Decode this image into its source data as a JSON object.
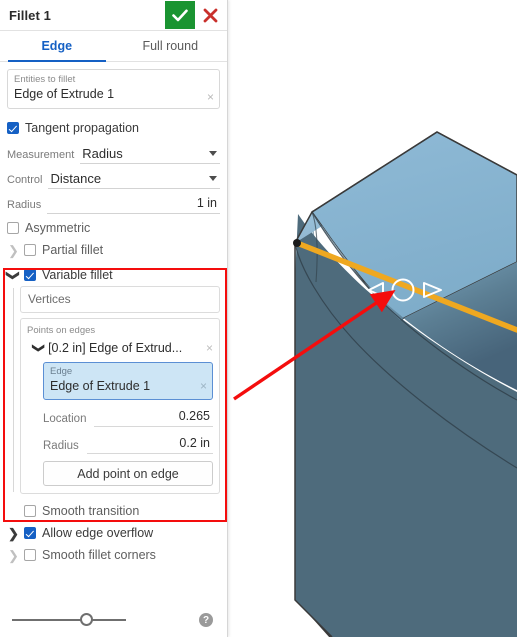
{
  "dialog": {
    "title": "Fillet 1",
    "accept_icon": "check-icon",
    "cancel_icon": "close-icon",
    "tabs": [
      {
        "label": "Edge",
        "active": true
      },
      {
        "label": "Full round",
        "active": false
      }
    ],
    "entities_field": {
      "label": "Entities to fillet",
      "value": "Edge of Extrude 1",
      "clear_glyph": "×"
    },
    "tangent_propagation": {
      "label": "Tangent propagation",
      "checked": true
    },
    "measurement": {
      "label": "Measurement",
      "value": "Radius"
    },
    "control": {
      "label": "Control",
      "value": "Distance"
    },
    "radius": {
      "label": "Radius",
      "value": "1 in"
    },
    "asymmetric": {
      "label": "Asymmetric",
      "checked": false
    },
    "partial_fillet": {
      "label": "Partial fillet",
      "checked": false
    },
    "variable_fillet": {
      "label": "Variable fillet",
      "checked": true,
      "vertices_placeholder": "Vertices",
      "points_on_edges": {
        "label": "Points on edges",
        "item_title": "[0.2 in] Edge of Extrud...",
        "item_clear_glyph": "×",
        "edge_field": {
          "label": "Edge",
          "value": "Edge of Extrude 1",
          "clear_glyph": "×"
        },
        "location": {
          "label": "Location",
          "value": "0.265"
        },
        "radius": {
          "label": "Radius",
          "value": "0.2 in"
        },
        "add_point_button": "Add point on edge"
      }
    },
    "smooth_transition": {
      "label": "Smooth transition",
      "checked": false
    },
    "allow_edge_overflow": {
      "label": "Allow edge overflow",
      "checked": true
    },
    "smooth_fillet_corners": {
      "label": "Smooth fillet corners",
      "checked": false
    },
    "footer": {
      "slider_value": 60,
      "help_glyph": "?"
    }
  },
  "viewport": {
    "handle_color": "#efa820",
    "annotation_color": "#f40d0d",
    "face_top_color": "#85b2cf",
    "face_front_color": "#4e6b7c",
    "edge_color": "#3a3a3a",
    "manipulator": {
      "left_arrow_icon": "triangle-left-icon",
      "circle_icon": "circle-handle-icon",
      "right_arrow_icon": "triangle-right-icon"
    }
  }
}
